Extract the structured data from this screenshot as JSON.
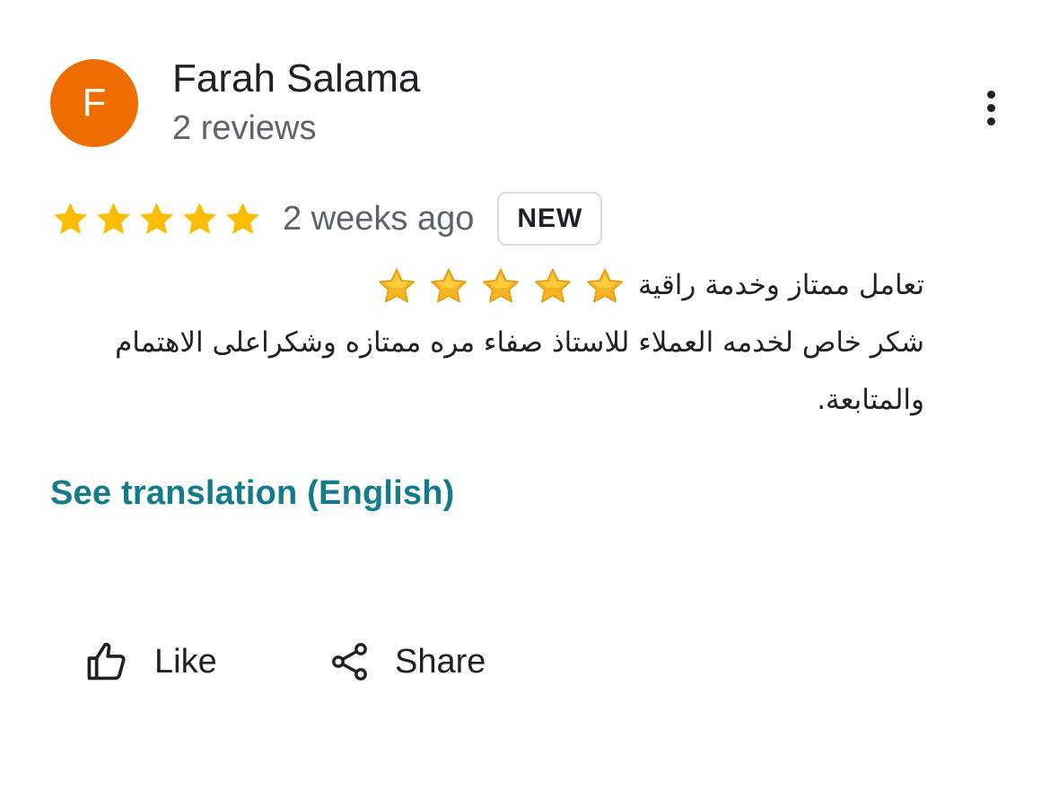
{
  "reviewer": {
    "initial": "F",
    "name": "Farah Salama",
    "review_count": "2 reviews",
    "avatar_color": "#ef6c00"
  },
  "menu": {
    "icon": "more-vertical-icon"
  },
  "review": {
    "rating": 5,
    "max_rating": 5,
    "star_color": "#fbbc04",
    "date": "2 weeks ago",
    "badge": "NEW",
    "text_line_1": "تعامل ممتاز وخدمة راقية",
    "text_emoji_stars": 5,
    "text_line_2": "شكر خاص لخدمه العملاء للاستاذ صفاء  مره ممتازه وشكراعلى الاهتمام والمتابعة."
  },
  "translation_link": {
    "label": "See translation (English)",
    "color": "#137b8a"
  },
  "actions": {
    "like_label": "Like",
    "like_icon": "thumbs-up-icon",
    "share_label": "Share",
    "share_icon": "share-icon"
  }
}
